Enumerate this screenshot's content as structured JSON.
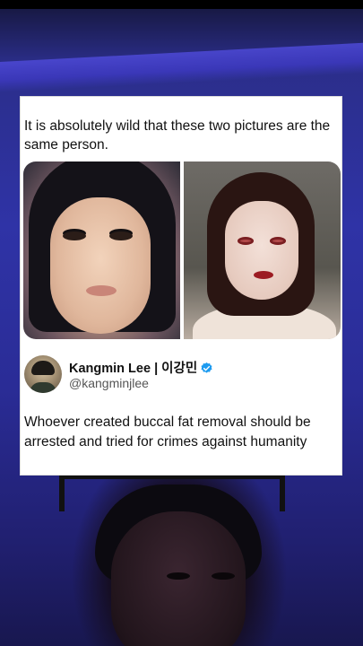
{
  "post": {
    "caption": "It is absolutely wild that these two pictures are the same person."
  },
  "quoted_tweet": {
    "author_name": "Kangmin Lee | 이강민",
    "author_handle": "@kangminjlee",
    "verified": true,
    "text": "Whoever created buccal fat removal should be arrested and tried for crimes against humanity"
  },
  "colors": {
    "background": "#2f33a6",
    "card": "#ffffff",
    "verified_badge": "#1d9bf0",
    "text": "#111111",
    "handle_text": "#555555"
  },
  "icons": {
    "verified": "verified-badge-icon"
  }
}
